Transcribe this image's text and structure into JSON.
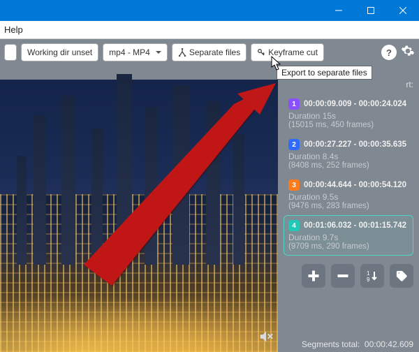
{
  "menubar": {
    "help": "Help"
  },
  "toolbar": {
    "working_dir": "Working dir unset",
    "format": "mp4 - MP4",
    "separate_files": "Separate files",
    "keyframe_cut": "Keyframe cut",
    "help_symbol": "?"
  },
  "tooltip": "Export to separate files",
  "truncated_label": "rt:",
  "segments": [
    {
      "num": "1",
      "badge_class": "b1",
      "range": "00:00:09.009 - 00:00:24.024",
      "duration": "Duration 15s",
      "sub": "(15015 ms, 450 frames)",
      "active": false
    },
    {
      "num": "2",
      "badge_class": "b2",
      "range": "00:00:27.227 - 00:00:35.635",
      "duration": "Duration 8.4s",
      "sub": "(8408 ms, 252 frames)",
      "active": false
    },
    {
      "num": "3",
      "badge_class": "b3",
      "range": "00:00:44.644 - 00:00:54.120",
      "duration": "Duration 9.5s",
      "sub": "(9476 ms, 283 frames)",
      "active": false
    },
    {
      "num": "4",
      "badge_class": "b4",
      "range": "00:01:06.032 - 00:01:15.742",
      "duration": "Duration 9.7s",
      "sub": "(9709 ms, 290 frames)",
      "active": true
    }
  ],
  "footer": {
    "label": "Segments total:",
    "value": "00:00:42.609"
  }
}
